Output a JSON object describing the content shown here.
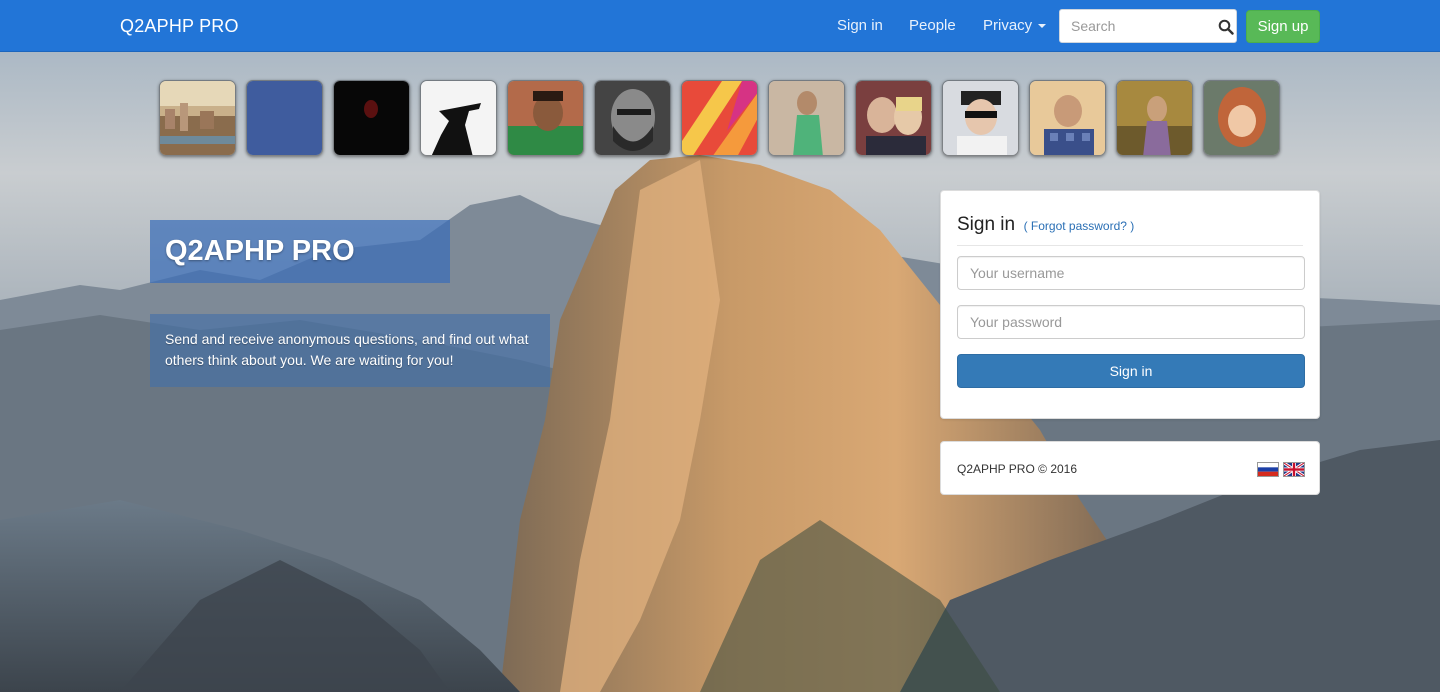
{
  "navbar": {
    "brand": "Q2APHP PRO",
    "links": {
      "signin": "Sign in",
      "people": "People",
      "privacy": "Privacy"
    },
    "search": {
      "placeholder": "Search",
      "value": ""
    },
    "signup_label": "Sign up",
    "bg_color": "#2275d7",
    "signup_color": "#58b957"
  },
  "avatars": [
    {
      "name": "avatar-city"
    },
    {
      "name": "avatar-blue-default"
    },
    {
      "name": "avatar-dark-red"
    },
    {
      "name": "avatar-silhouette-hat"
    },
    {
      "name": "avatar-man-green"
    },
    {
      "name": "avatar-bearded-man"
    },
    {
      "name": "avatar-colorful-stripes"
    },
    {
      "name": "avatar-woman-green-dress"
    },
    {
      "name": "avatar-couple"
    },
    {
      "name": "avatar-guy-sunglasses"
    },
    {
      "name": "avatar-boy-checkered"
    },
    {
      "name": "avatar-man-outdoors"
    },
    {
      "name": "avatar-little-girl"
    }
  ],
  "hero": {
    "title": "Q2APHP PRO",
    "description": "Send and receive anonymous questions, and find out what others think about you. We are waiting for you!"
  },
  "signin_panel": {
    "title": "Sign in",
    "forgot_link": "( Forgot password? )",
    "username_placeholder": "Your username",
    "password_placeholder": "Your password",
    "button_label": "Sign in",
    "button_color": "#347ab7"
  },
  "footer": {
    "copyright": "Q2APHP PRO © 2016",
    "languages": [
      "russian-flag",
      "english-flag"
    ]
  }
}
